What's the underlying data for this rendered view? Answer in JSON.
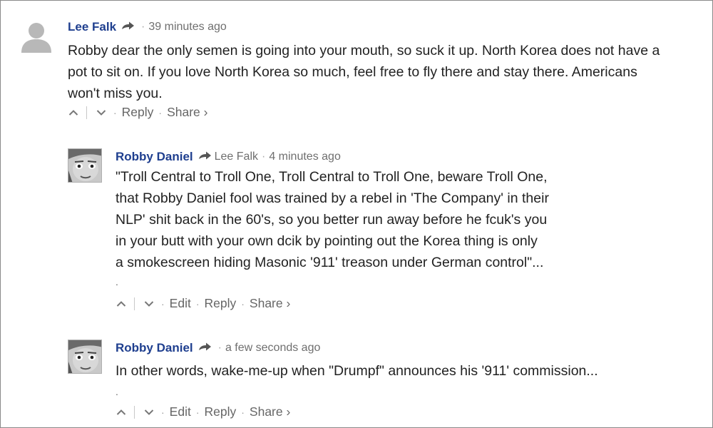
{
  "comments": [
    {
      "author": "Lee Falk",
      "reply_to": "",
      "time": "39 minutes ago",
      "body_lines": [
        "Robby dear the only semen is going into your mouth, so suck it up. North Korea does not have a",
        "pot to sit on. If you love North Korea so much, feel free to fly there and stay there. Americans",
        "won't miss you."
      ],
      "actions": {
        "reply": "Reply",
        "share": "Share ›"
      }
    },
    {
      "author": "Robby Daniel",
      "reply_to": "Lee Falk",
      "time": "4 minutes ago",
      "body_lines": [
        "\"Troll Central to Troll One, Troll Central to Troll One, beware Troll One,",
        "that Robby Daniel fool was trained by a rebel in 'The Company' in their",
        "NLP' shit back in the 60's, so you better run away before he fcuk's you",
        "in your butt with your own dcik by pointing out the Korea thing is only",
        "a smokescreen hiding Masonic '911' treason under German control\"..."
      ],
      "trail": ".",
      "actions": {
        "edit": "Edit",
        "reply": "Reply",
        "share": "Share ›"
      }
    },
    {
      "author": "Robby Daniel",
      "reply_to": "",
      "time": "a few seconds ago",
      "body_lines": [
        "In other words, wake-me-up when \"Drumpf\" announces his '911' commission..."
      ],
      "trail": ".",
      "actions": {
        "edit": "Edit",
        "reply": "Reply",
        "share": "Share ›"
      }
    }
  ],
  "separator": "·",
  "colors": {
    "author": "#1f3f8f",
    "muted": "#6f6f6f",
    "body": "#222222"
  },
  "icons": [
    "default-avatar-icon",
    "reply-arrow-icon",
    "upvote-icon",
    "downvote-icon"
  ]
}
